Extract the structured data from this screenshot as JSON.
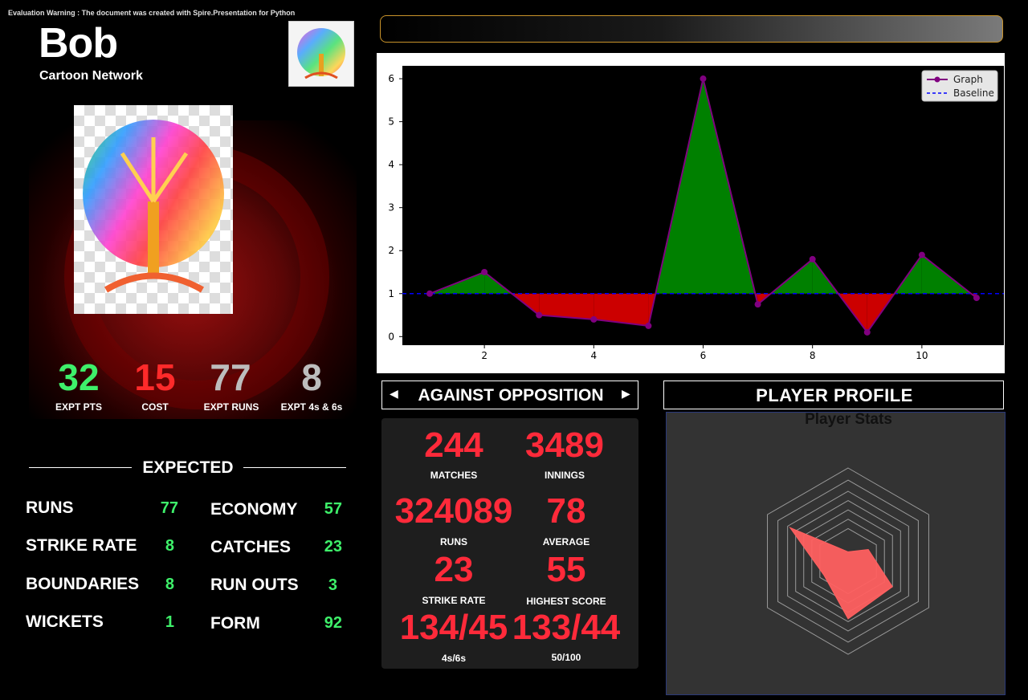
{
  "warning": "Evaluation Warning : The document was created with Spire.Presentation for Python",
  "player": {
    "name": "Bob",
    "team": "Cartoon Network",
    "logo_icon": "tree-of-life-logo",
    "photo_icon": "tree-of-life-photo"
  },
  "kpis": [
    {
      "value": "32",
      "label": "EXPT PTS",
      "color": "#3ef06a"
    },
    {
      "value": "15",
      "label": "COST",
      "color": "#ff2a2a"
    },
    {
      "value": "77",
      "label": "EXPT RUNS",
      "color": "#bdbdbd"
    },
    {
      "value": "8",
      "label": "EXPT 4s & 6s",
      "color": "#bdbdbd"
    }
  ],
  "expected": {
    "title": "EXPECTED",
    "left": [
      {
        "label": "RUNS",
        "value": "77"
      },
      {
        "label": "STRIKE RATE",
        "value": "8"
      },
      {
        "label": "BOUNDARIES",
        "value": "8"
      },
      {
        "label": "WICKETS",
        "value": "1"
      }
    ],
    "right": [
      {
        "label": "ECONOMY",
        "value": "57"
      },
      {
        "label": "CATCHES",
        "value": "23"
      },
      {
        "label": "RUN OUTS",
        "value": "3"
      },
      {
        "label": "FORM",
        "value": "92"
      }
    ]
  },
  "chart_data": {
    "type": "line",
    "x": [
      1,
      2,
      3,
      4,
      5,
      6,
      7,
      8,
      9,
      10,
      11
    ],
    "series": [
      {
        "name": "Graph",
        "values": [
          1.0,
          1.5,
          0.5,
          0.4,
          0.25,
          6.0,
          0.75,
          1.8,
          0.1,
          1.9,
          0.9
        ],
        "color": "#800080"
      },
      {
        "name": "Baseline",
        "values": [
          1,
          1,
          1,
          1,
          1,
          1,
          1,
          1,
          1,
          1,
          1
        ],
        "color": "#0000ff"
      }
    ],
    "fill_above_color": "#008000",
    "fill_below_color": "#cc0000",
    "xticks": [
      2,
      4,
      6,
      8,
      10
    ],
    "yticks": [
      0,
      1,
      2,
      3,
      4,
      5,
      6
    ],
    "xlim": [
      0.5,
      11.5
    ],
    "ylim": [
      -0.2,
      6.3
    ],
    "legend": "top-right",
    "background": "#000000"
  },
  "opposition": {
    "title": "AGAINST OPPOSITION",
    "stats": [
      {
        "value": "244",
        "label": "MATCHES"
      },
      {
        "value": "3489",
        "label": "INNINGS"
      },
      {
        "value": "324089",
        "label": "RUNS"
      },
      {
        "value": "78",
        "label": "AVERAGE"
      },
      {
        "value": "23",
        "label": "STRIKE RATE"
      },
      {
        "value": "55",
        "label": "HIGHEST SCORE"
      },
      {
        "value": "134/45",
        "label": "4s/6s"
      },
      {
        "value": "133/44",
        "label": "50/100"
      }
    ]
  },
  "profile": {
    "title": "PLAYER PROFILE",
    "radar_title": "Player Stats",
    "radar_values": [
      0.1,
      0.25,
      0.55,
      0.62,
      0.3,
      0.72
    ],
    "radar_color": "#ff6060"
  }
}
